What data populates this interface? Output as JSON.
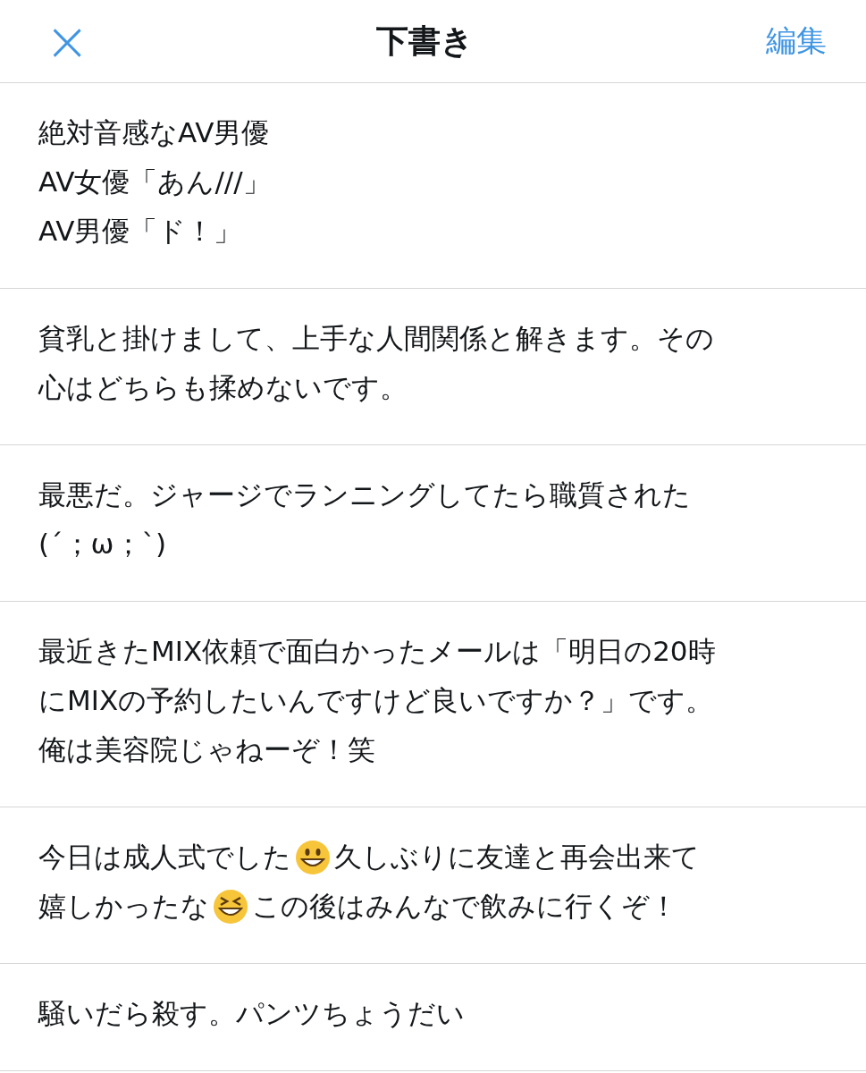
{
  "header": {
    "close": "×",
    "title": "下書き",
    "edit": "編集"
  },
  "drafts": [
    {
      "lines": [
        [
          {
            "kind": "text",
            "text": "絶対音感なAV男優"
          }
        ],
        [
          {
            "kind": "text",
            "text": "AV女優「あん///」"
          }
        ],
        [
          {
            "kind": "text",
            "text": "AV男優「ド！」"
          }
        ]
      ]
    },
    {
      "lines": [
        [
          {
            "kind": "text",
            "text": "貧乳と掛けまして、上手な人間関係と解きます。その"
          }
        ],
        [
          {
            "kind": "text",
            "text": "心はどちらも揉めないです。"
          }
        ]
      ]
    },
    {
      "lines": [
        [
          {
            "kind": "text",
            "text": "最悪だ。ジャージでランニングしてたら職質された"
          }
        ],
        [
          {
            "kind": "text",
            "text": "(´；ω；`)"
          }
        ]
      ]
    },
    {
      "lines": [
        [
          {
            "kind": "text",
            "text": "最近きたMIX依頼で面白かったメールは「明日の20時"
          }
        ],
        [
          {
            "kind": "text",
            "text": "にMIXの予約したいんですけど良いですか？」です。"
          }
        ],
        [
          {
            "kind": "text",
            "text": "俺は美容院じゃねーぞ！笑"
          }
        ]
      ]
    },
    {
      "lines": [
        [
          {
            "kind": "text",
            "text": "今日は成人式でした"
          },
          {
            "kind": "grin"
          },
          {
            "kind": "text",
            "text": "久しぶりに友達と再会出来て"
          }
        ],
        [
          {
            "kind": "text",
            "text": "嬉しかったな"
          },
          {
            "kind": "laugh"
          },
          {
            "kind": "text",
            "text": "この後はみんなで飲みに行くぞ！"
          }
        ]
      ]
    },
    {
      "lines": [
        [
          {
            "kind": "text",
            "text": "騒いだら殺す。パンツちょうだい"
          }
        ]
      ]
    }
  ]
}
